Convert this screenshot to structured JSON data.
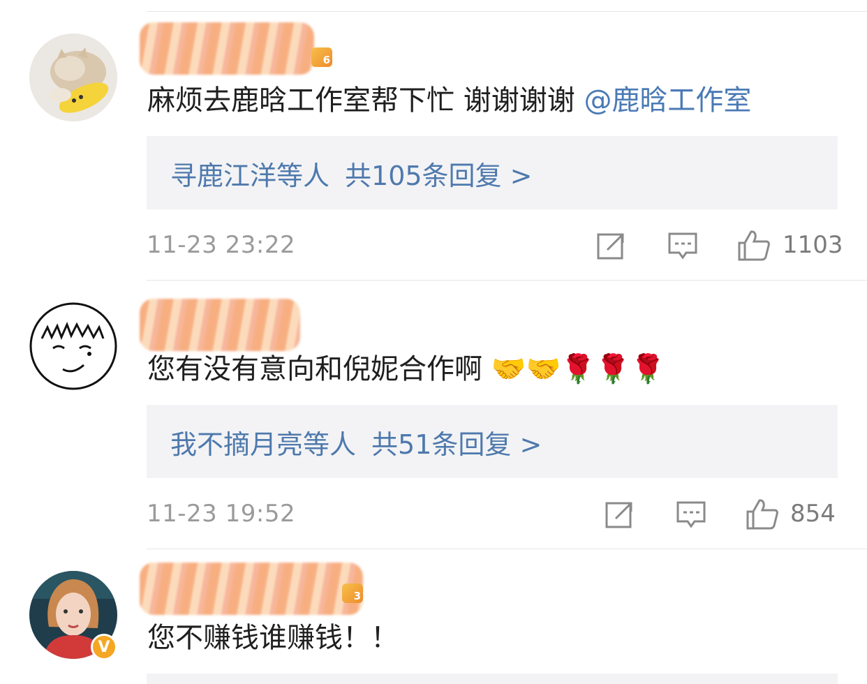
{
  "comments": [
    {
      "badge_level": "6",
      "text": "麻烦去鹿晗工作室帮下忙 谢谢谢谢",
      "mention": "@鹿晗工作室",
      "emoji": "",
      "reply_names": "寻鹿江洋等人",
      "reply_count": "共105条回复 >",
      "time": "11-23 23:22",
      "likes": "1103"
    },
    {
      "text": "您有没有意向和倪妮合作啊",
      "emoji": "🤝🤝🌹🌹🌹",
      "reply_names": "我不摘月亮等人",
      "reply_count": "共51条回复 >",
      "time": "11-23 19:52",
      "likes": "854"
    },
    {
      "badge_level": "3",
      "text": "您不赚钱谁赚钱！！",
      "verified_badge": "V"
    }
  ],
  "icons": {
    "share": "share-icon",
    "comment": "comment-icon",
    "like": "thumbs-up-icon",
    "verified": "verified-v-icon"
  },
  "colors": {
    "link": "#4e79ad",
    "reply_bg": "#f3f3f5",
    "meta": "#9a9a9a",
    "verified": "#f5a623"
  }
}
